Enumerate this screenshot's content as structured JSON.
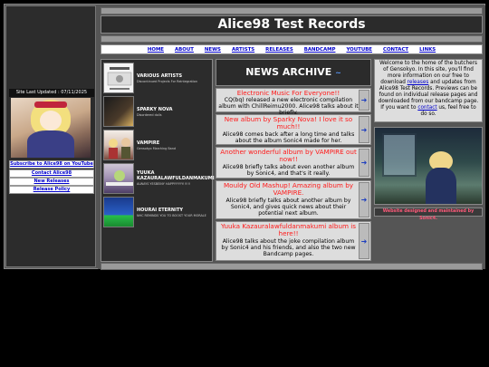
{
  "sidebar": {
    "last_updated": "Site Last Updated : 07/11/2025",
    "links": [
      "Subscribe to Alice98 on YouTube",
      "Contact Alice98",
      "New Releases",
      "Release Policy"
    ]
  },
  "header": {
    "title": "Alice98 Test Records"
  },
  "nav": [
    "HOME",
    "ABOUT",
    "NEWS",
    "ARTISTS",
    "RELEASES",
    "BANDCAMP",
    "YOUTUBE",
    "CONTACT",
    "LINKS"
  ],
  "projects": [
    {
      "name": "VARIOUS ARTISTS",
      "desc": "Discontinued Projects For Reintegration"
    },
    {
      "name": "SPARKY NOVA",
      "desc": "Disordered dolls"
    },
    {
      "name": "VAMPIRE",
      "desc": "Gensokyo Marching Band"
    },
    {
      "name": "YUUKA KAZAURALAWFULDANMAKUMI",
      "desc": "ALWAYS YESBEINY HAPPYYYYY!!!!!!"
    },
    {
      "name": "HOURAI ETERNITY",
      "desc": "NHC REMINDS YOU TO BOOST YOUR MORALE"
    }
  ],
  "news": {
    "heading": "NEWS ARCHIVE",
    "heading_tilde": "~",
    "items": [
      {
        "title": "Electronic Music For Everyone!!",
        "body": "CQ(bq) released a new electronic compilation album with ChillReimu2000. Alice98 talks about it briefly."
      },
      {
        "title": "New album by Sparky Nova! I love it so much!!",
        "body": "Alice98 comes back after a long time and talks about the album Sonic4 made for her."
      },
      {
        "title": "Another wonderful album by VAMPIRE out now!!",
        "body": "Alice98 briefly talks about even another album by Sonic4, and that's it really."
      },
      {
        "title": "Mouldy Old Mashup! Amazing album by VAMPIRE.",
        "body": "Alice98 briefly talks about another album by Sonic4, and gives quick news about their potential next album."
      },
      {
        "title": "Yuuka Kazauralawfuldanmakumi album is here!!",
        "body": "Alice98 talks about the joke compilation album by Sonic4 and his friends, and also the two new Bandcamp pages."
      }
    ]
  },
  "welcome": {
    "pre": "Welcome to the home of the butchers of Gensokyo. In this site, you'll find more information on our free to download ",
    "link1": "releases",
    "mid": " and updates from Alice98 Test Records. Previews can be found on individual release pages and downloaded from our bandcamp page. If you want to ",
    "link2": "contact",
    "post": " us, feel free to do so."
  },
  "credit": "Website designed and maintained by Sonic4.",
  "icons": {
    "news_arrow": "arrow-right-icon"
  }
}
